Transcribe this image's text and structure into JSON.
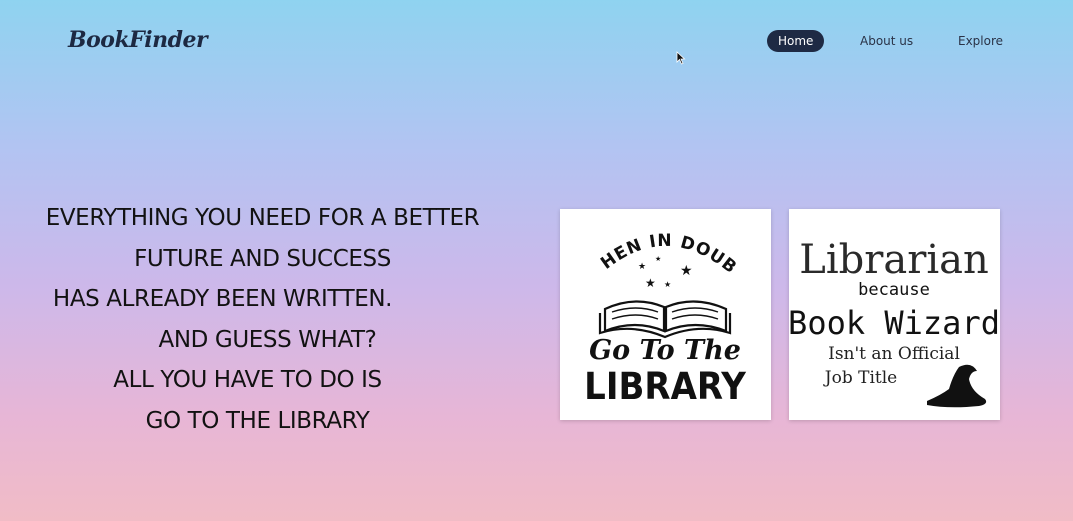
{
  "header": {
    "logo": "BookFinder",
    "nav": [
      {
        "label": "Home",
        "active": true
      },
      {
        "label": "About us",
        "active": false
      },
      {
        "label": "Explore",
        "active": false
      }
    ]
  },
  "hero": {
    "lines": [
      "EVERYTHING YOU NEED FOR A BETTER",
      "FUTURE AND SUCCESS",
      "HAS ALREADY BEEN WRITTEN.",
      "AND GUESS WHAT?",
      "ALL YOU HAVE TO DO IS",
      "GO TO THE LIBRARY"
    ]
  },
  "cards": [
    {
      "top": "WHEN IN DOUBT",
      "script": "Go To The",
      "bottom": "LIBRARY",
      "icon": "open-book-with-stars-icon"
    },
    {
      "line1": "Librarian",
      "line2": "because",
      "line3": "Book Wizard",
      "line4": "Isn't an Official",
      "line5": "Job Title",
      "icon": "wizard-hat-icon"
    }
  ],
  "colors": {
    "nav_active_bg": "#1e2a44",
    "text_dark": "#121212",
    "logo": "#1d2942"
  }
}
